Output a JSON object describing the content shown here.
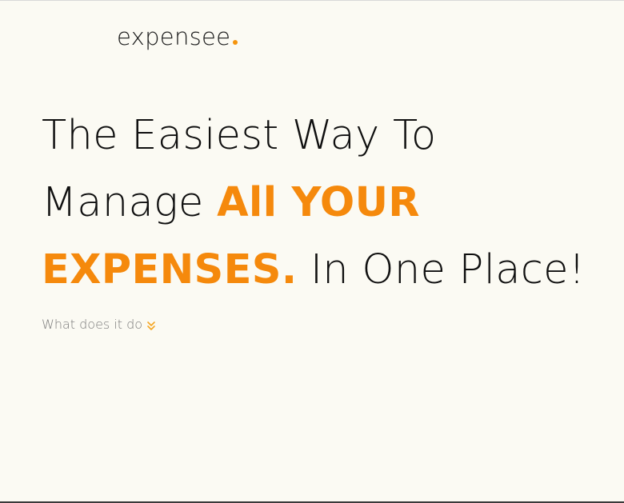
{
  "brand": {
    "name": "expensee",
    "dot_color": "#f5940c"
  },
  "hero": {
    "line1": "The Easiest Way To",
    "line2_plain": "Manage ",
    "line2_accent": "All YOUR",
    "line3_accent": "EXPENSES.",
    "line3_plain": " In One Place!",
    "accent_color": "#f5890c"
  },
  "cta": {
    "label": "What does it do",
    "icon": "double-chevron-down-icon"
  }
}
